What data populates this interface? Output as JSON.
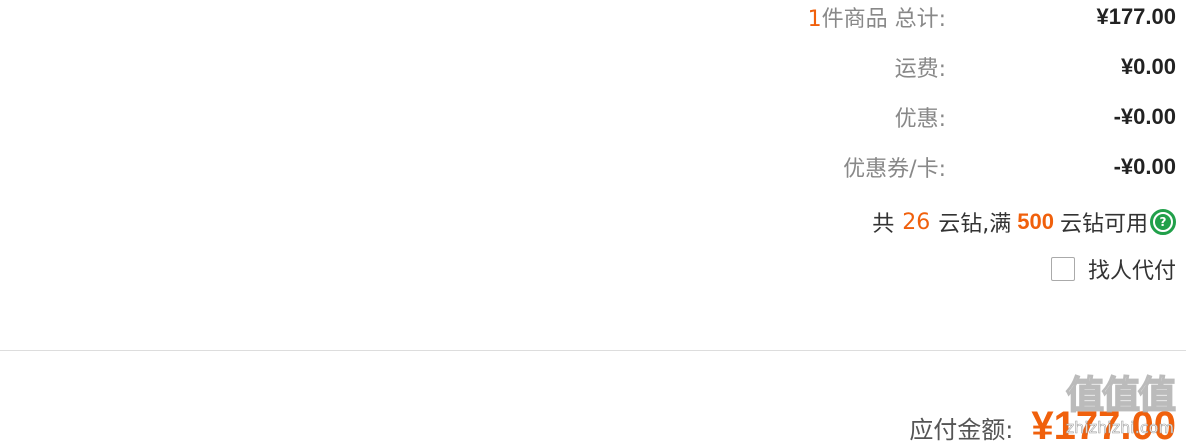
{
  "order_summary": {
    "item_count": "1",
    "count_label": "件商品 总计:",
    "total_value": "¥177.00",
    "shipping_label": "运费:",
    "shipping_value": "¥0.00",
    "discount_label": "优惠:",
    "discount_value": "-¥0.00",
    "coupon_label": "优惠券/卡:",
    "coupon_value": "-¥0.00"
  },
  "coins": {
    "prefix": "共",
    "available": "26",
    "middle": "云钻,满",
    "threshold": "500",
    "suffix": "云钻可用",
    "help_icon": "question-circle-icon",
    "help_glyph": "?"
  },
  "proxy_pay": {
    "label": "找人代付",
    "checked": false
  },
  "payable": {
    "label": "应付金额:",
    "amount": "¥177.00"
  },
  "watermark": {
    "logo": "值值值",
    "url": "zhizhizhi.com"
  },
  "colors": {
    "accent": "#f0600c",
    "help_icon": "#21a04a",
    "divider": "#dddddd"
  }
}
